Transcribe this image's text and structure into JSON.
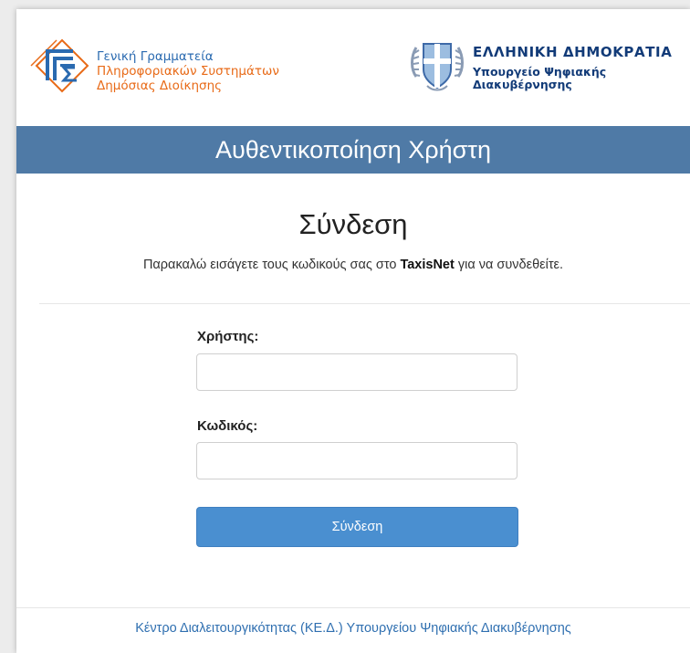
{
  "header": {
    "gsis": {
      "line1": "Γενική Γραμματεία",
      "line2": "Πληροφοριακών Συστημάτων",
      "line3": "Δημόσιας Διοίκησης"
    },
    "gov": {
      "title": "ΕΛΛΗΝΙΚΗ ΔΗΜΟΚΡΑΤΙΑ",
      "line1": "Υπουργείο Ψηφιακής",
      "line2": "Διακυβέρνησης"
    }
  },
  "titlebar": {
    "title": "Αυθεντικοποίηση Χρήστη"
  },
  "login": {
    "heading": "Σύνδεση",
    "instructions_before": "Παρακαλώ εισάγετε τους κωδικούς σας στο ",
    "instructions_brand": "TaxisNet",
    "instructions_after": " για να συνδεθείτε.",
    "username_label": "Χρήστης:",
    "username_value": "",
    "password_label": "Κωδικός:",
    "password_value": "",
    "submit_label": "Σύνδεση"
  },
  "footer": {
    "link": "Κέντρο Διαλειτουργικότητας (ΚΕ.Δ.) Υπουργείου Ψηφιακής Διακυβέρνησης"
  },
  "colors": {
    "titlebar_bg": "#4f7aa6",
    "button_bg": "#4a8fd0",
    "footer_link": "#2f6fb0",
    "gsis_blue": "#2a6ab0",
    "gsis_orange": "#e86a17",
    "gov_navy": "#123b78"
  },
  "icons": {
    "gsis_logo": "gsis-logo-icon",
    "crest": "greek-coat-of-arms-icon"
  }
}
